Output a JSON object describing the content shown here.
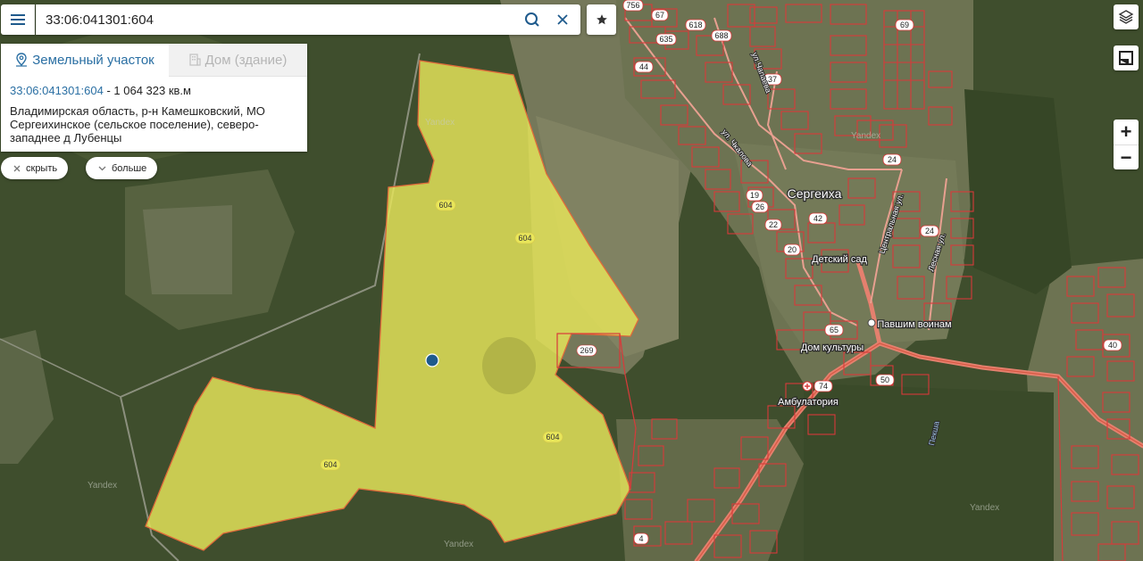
{
  "search": {
    "value": "33:06:041301:604"
  },
  "tabs": {
    "land": "Земельный участок",
    "house": "Дом (здание)"
  },
  "parcel": {
    "id": "33:06:041301:604",
    "separator": " - ",
    "area": "1 064 323 кв.м",
    "address": "Владимирская область, р-н Камешковский, МО Сергеихинское (сельское поселение), северо-западнее д Лубенцы"
  },
  "buttons": {
    "hide": "скрыть",
    "more": "больше"
  },
  "zoom": {
    "in": "+",
    "out": "−"
  },
  "map": {
    "parcel_labels": [
      "604",
      "604",
      "604",
      "604",
      "269"
    ],
    "place_labels": [
      "Сергеиха",
      "Детский сад",
      "Павшим воинам",
      "Дом культуры",
      "Амбулатория"
    ],
    "street_labels": [
      "ул. Чкалова",
      "ул.Чапаева",
      "Центральная ул.",
      "Лесная ул.",
      "Пекша"
    ],
    "house_numbers": [
      "756",
      "67",
      "618",
      "688",
      "635",
      "44",
      "37",
      "69",
      "24",
      "19",
      "26",
      "22",
      "42",
      "20",
      "24",
      "65",
      "74",
      "50",
      "40",
      "4"
    ],
    "watermarks": [
      "Yandex",
      "Yandex",
      "Yandex",
      "Yandex",
      "Yandex"
    ],
    "colors": {
      "parcel_fill": "#e8e65a",
      "parcel_stroke": "#e06a3a",
      "cadastre": "#d83a3a",
      "road": "#e5806e",
      "marker": "#1e5a8c"
    }
  }
}
